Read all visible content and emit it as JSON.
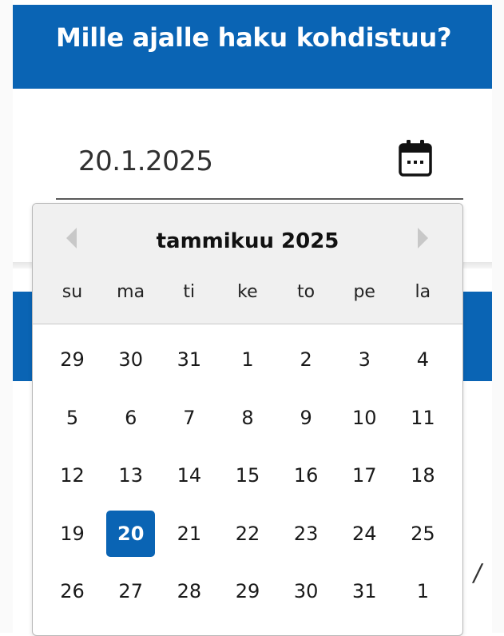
{
  "header": {
    "title": "Mille ajalle haku kohdistuu?"
  },
  "date_field": {
    "value": "20.1.2025",
    "icon": "calendar-icon"
  },
  "stray_text": "/",
  "datepicker": {
    "month_label": "tammikuu 2025",
    "prev_icon": "chevron-left-icon",
    "next_icon": "chevron-right-icon",
    "weekdays": [
      "su",
      "ma",
      "ti",
      "ke",
      "to",
      "pe",
      "la"
    ],
    "weeks": [
      [
        "29",
        "30",
        "31",
        "1",
        "2",
        "3",
        "4"
      ],
      [
        "5",
        "6",
        "7",
        "8",
        "9",
        "10",
        "11"
      ],
      [
        "12",
        "13",
        "14",
        "15",
        "16",
        "17",
        "18"
      ],
      [
        "19",
        "20",
        "21",
        "22",
        "23",
        "24",
        "25"
      ],
      [
        "26",
        "27",
        "28",
        "29",
        "30",
        "31",
        "1"
      ]
    ],
    "selected_day": "20",
    "colors": {
      "accent": "#0a64b4",
      "header_bg": "#f0f0f0",
      "nav_arrow": "#c8c8c8"
    }
  }
}
